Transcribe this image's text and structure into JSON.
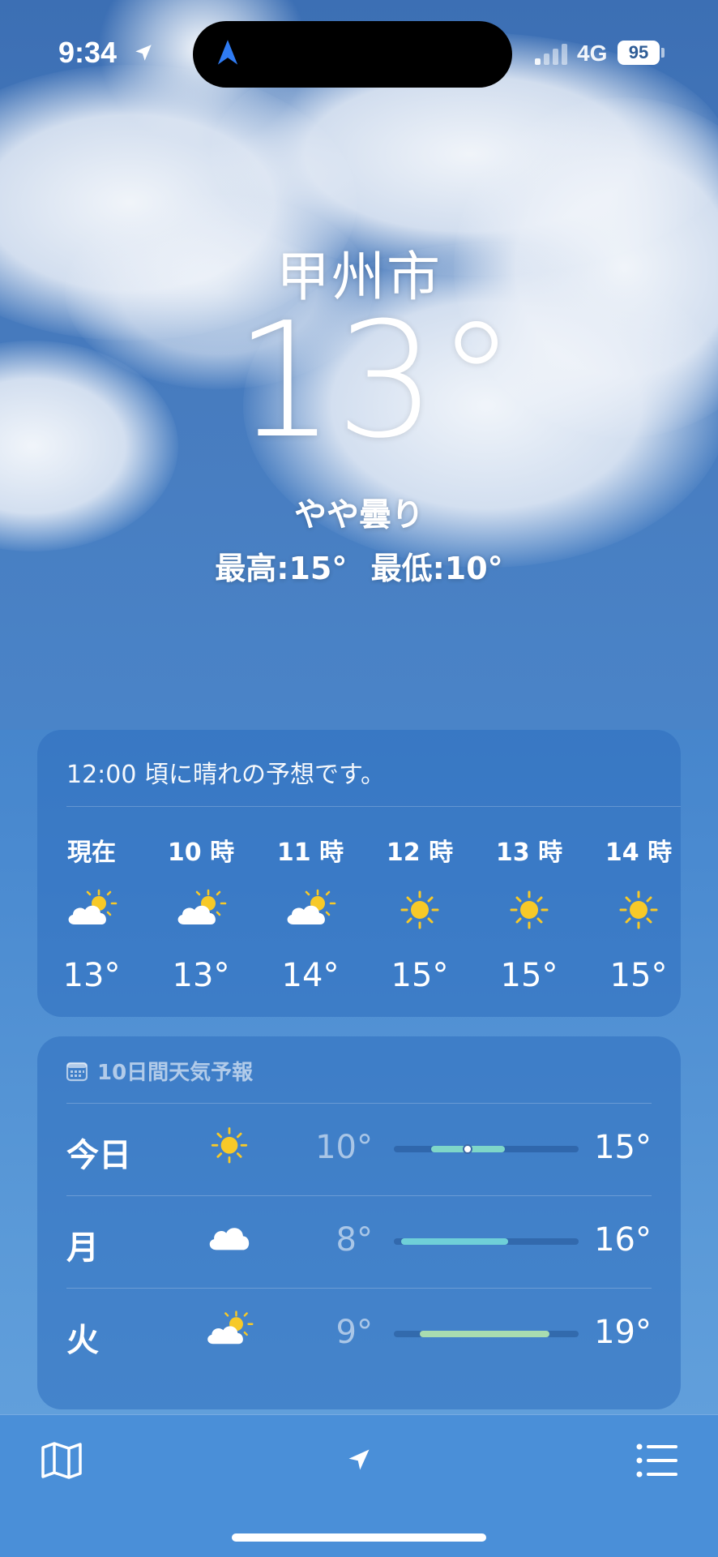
{
  "status_bar": {
    "time": "9:34",
    "network": "4G",
    "battery": "95"
  },
  "header": {
    "city": "甲州市",
    "temperature": "13°",
    "condition": "やや曇り",
    "high": "最高:15°",
    "low": "最低:10°"
  },
  "hourly": {
    "note": "12:00 頃に晴れの予想です。",
    "items": [
      {
        "label": "現在",
        "icon": "partly-sunny-icon",
        "temp": "13°"
      },
      {
        "label": "10 時",
        "icon": "partly-sunny-icon",
        "temp": "13°"
      },
      {
        "label": "11 時",
        "icon": "partly-sunny-icon",
        "temp": "14°"
      },
      {
        "label": "12 時",
        "icon": "sun-icon",
        "temp": "15°"
      },
      {
        "label": "13 時",
        "icon": "sun-icon",
        "temp": "15°"
      },
      {
        "label": "14 時",
        "icon": "sun-icon",
        "temp": "15°"
      }
    ]
  },
  "daily": {
    "title": "10日間天気予報",
    "days": [
      {
        "name": "今日",
        "icon": "sun-icon",
        "low": "10°",
        "high": "15°",
        "bar_start": 0.2,
        "bar_end": 0.6,
        "current": 0.4,
        "color": "#7fd6c8"
      },
      {
        "name": "月",
        "icon": "cloud-icon",
        "low": "8°",
        "high": "16°",
        "bar_start": 0.04,
        "bar_end": 0.62,
        "color": "#6fd0d8"
      },
      {
        "name": "火",
        "icon": "partly-sunny-icon",
        "low": "9°",
        "high": "19°",
        "bar_start": 0.14,
        "bar_end": 0.84,
        "color": "#a8dcb0"
      }
    ]
  },
  "colors": {
    "accent_sun": "#f7c928",
    "card_bg": "#2e6ebe"
  }
}
